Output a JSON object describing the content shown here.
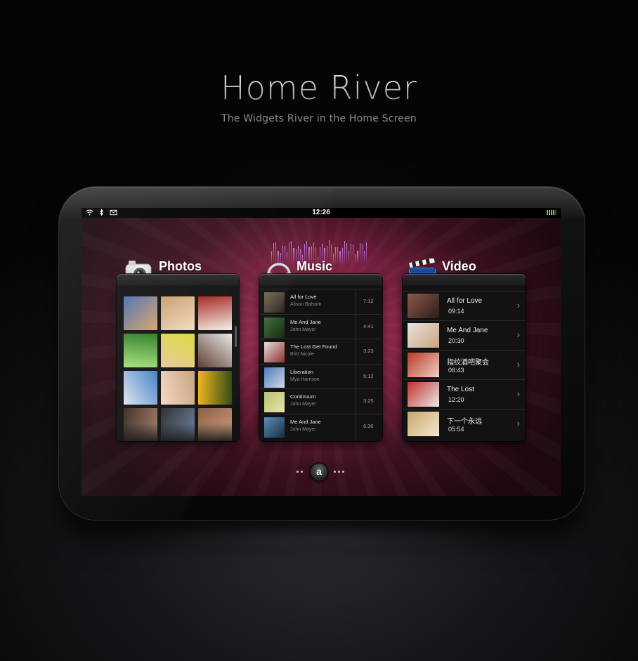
{
  "hero": {
    "title": "Home River",
    "subtitle": "The Widgets River in the Home Screen"
  },
  "status_bar": {
    "time": "12:26",
    "icons": [
      "wifi-icon",
      "bluetooth-icon",
      "mail-icon"
    ],
    "battery_level": 0.75
  },
  "widgets": {
    "photos": {
      "title": "Photos",
      "icon": "camera-icon",
      "thumbnails": [
        {
          "name": "photo-woman-hat",
          "colors": [
            "#4a6fb0",
            "#d9a56a"
          ]
        },
        {
          "name": "photo-kitten",
          "colors": [
            "#c79d6e",
            "#f2dcc0"
          ]
        },
        {
          "name": "photo-coffee-cup",
          "colors": [
            "#a3241b",
            "#f5f0e8"
          ]
        },
        {
          "name": "photo-water-drop",
          "colors": [
            "#2e7d26",
            "#a6e07a"
          ]
        },
        {
          "name": "photo-girl-yellow",
          "colors": [
            "#d9dc3a",
            "#e9c59b"
          ]
        },
        {
          "name": "photo-woman-smile",
          "colors": [
            "#e8e8e8",
            "#5b3b2b"
          ]
        },
        {
          "name": "photo-mug",
          "colors": [
            "#3e7fc7",
            "#dfe6ee"
          ]
        },
        {
          "name": "photo-bubblegum",
          "colors": [
            "#c7a27c",
            "#f4d7c4"
          ]
        },
        {
          "name": "photo-sunflower",
          "colors": [
            "#2d4a12",
            "#f0b419"
          ]
        },
        {
          "name": "photo-face-1",
          "colors": [
            "#a57c66",
            "#3a2a22"
          ]
        },
        {
          "name": "photo-face-2",
          "colors": [
            "#6f86a8",
            "#2a2a2a"
          ]
        },
        {
          "name": "photo-baby",
          "colors": [
            "#d3a37f",
            "#8a5b3f"
          ]
        }
      ]
    },
    "music": {
      "title": "Music",
      "icon": "headphones-icon",
      "tracks": [
        {
          "song": "All for Love",
          "artist": "Alison Balsom",
          "duration": "7:12",
          "colors": [
            "#7a6a55",
            "#2c2520"
          ]
        },
        {
          "song": "Me And Jane",
          "artist": "John Mayer",
          "duration": "4:41",
          "colors": [
            "#3f6e3a",
            "#1a2b18"
          ]
        },
        {
          "song": "The Lost Get Found",
          "artist": "Britt Nicole",
          "duration": "3:23",
          "colors": [
            "#e8e0d8",
            "#8a2f2f"
          ]
        },
        {
          "song": "Liberation",
          "artist": "Mya Harrison",
          "duration": "5:12",
          "colors": [
            "#4e79b9",
            "#cfd9e8"
          ]
        },
        {
          "song": "Continuum",
          "artist": "John Mayer",
          "duration": "3:25",
          "colors": [
            "#b8c26a",
            "#e8e3b0"
          ]
        },
        {
          "song": "Me And Jane",
          "artist": "John Mayer",
          "duration": "6:36",
          "colors": [
            "#5a8fc0",
            "#1b2c3e"
          ]
        }
      ]
    },
    "video": {
      "title": "Video",
      "icon": "clapperboard-icon",
      "items": [
        {
          "title": "All for Love",
          "duration": "09:14",
          "colors": [
            "#8a5a4a",
            "#2b1d18"
          ]
        },
        {
          "title": "Me And Jane",
          "duration": "20:30",
          "colors": [
            "#e7e2de",
            "#c9a57f"
          ]
        },
        {
          "title": "指纹酒吧聚会",
          "duration": "06:43",
          "colors": [
            "#b83a2a",
            "#f0d0c0"
          ]
        },
        {
          "title": "The Lost",
          "duration": "12:20",
          "colors": [
            "#c2322b",
            "#eaeaea"
          ]
        },
        {
          "title": "下一个永远",
          "duration": "05:54",
          "colors": [
            "#c9a66b",
            "#f3e7cf"
          ]
        }
      ]
    }
  },
  "pager": {
    "center_label": "a",
    "page_count": 7,
    "current_page": 3
  }
}
